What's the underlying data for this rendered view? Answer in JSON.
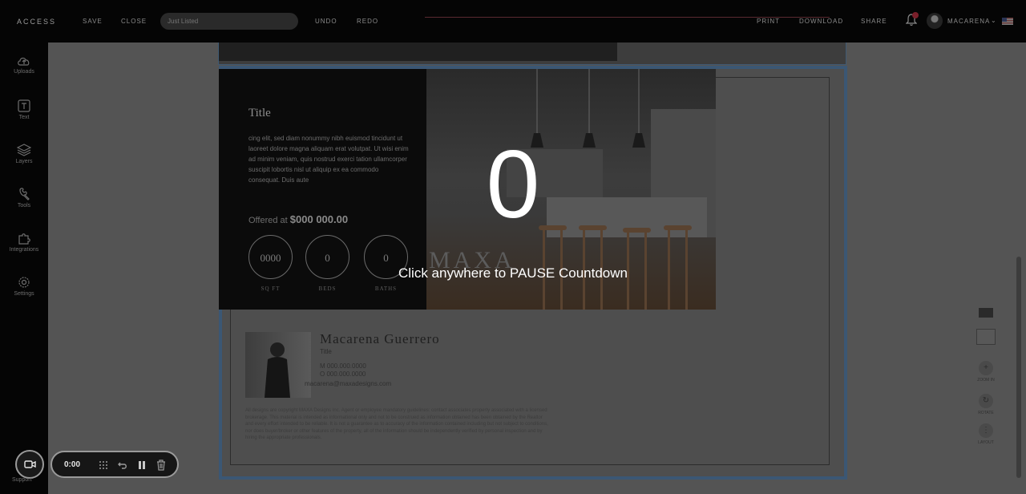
{
  "topbar": {
    "logo": "ACCESS",
    "save_label": "SAVE",
    "close_label": "CLOSE",
    "status_placeholder": "Just Listed",
    "undo_label": "UNDO",
    "redo_label": "REDO",
    "print_label": "PRINT",
    "download_label": "DOWNLOAD",
    "share_label": "SHARE",
    "user_name": "MACARENA"
  },
  "sidebar": {
    "items": [
      {
        "label": "Uploads",
        "icon": "cloud-upload-icon"
      },
      {
        "label": "Text",
        "icon": "text-icon"
      },
      {
        "label": "Layers",
        "icon": "layers-icon"
      },
      {
        "label": "Tools",
        "icon": "wrench-icon"
      },
      {
        "label": "Integrations",
        "icon": "puzzle-icon"
      },
      {
        "label": "Settings",
        "icon": "gear-icon"
      }
    ],
    "support_label": "Support"
  },
  "flyer": {
    "title": "Title",
    "body": "cing elit, sed diam nonummy nibh euismod tincidunt ut laoreet dolore magna aliquam erat volutpat. Ut wisi enim ad minim veniam, quis nostrud exerci tation ullamcorper suscipit lobortis nisl ut aliquip ex ea commodo consequat. Duis aute",
    "price_prefix": "Offered at",
    "price": "$000 000.00",
    "stats": [
      {
        "value": "0000",
        "label": "SQ FT"
      },
      {
        "value": "0",
        "label": "BEDS"
      },
      {
        "value": "0",
        "label": "BATHS"
      }
    ],
    "brand": "MAXA",
    "agent_name": "Macarena Guerrero",
    "agent_title": "Title",
    "agent_mobile": "M 000.000.0000",
    "agent_office": "O 000.000.0000",
    "agent_email": "macarena@maxadesigns.com",
    "disclaimer": "All designs are copyright MAXA Designs Inc. Agent or employee mandatory guidelines: contact associates property associated with a licensed brokerage. This material is intended as informational only and not to be construed as information obtained has been obtained by the Realtor and every effort intended to be reliable. It is not a guarantee as to accuracy of the information contained including but not subject to conditions, nor does buyer/broker or other features of the property, all of the information should be independently verified by personal inspection and by hiring the appropriate professionals."
  },
  "right_tools": {
    "zoom_label": "ZOOM IN",
    "rotate_label": "ROTATE",
    "layout_label": "LAYOUT"
  },
  "countdown": {
    "value": "0",
    "message": "Click anywhere to PAUSE Countdown"
  },
  "recorder": {
    "time": "0:00"
  }
}
